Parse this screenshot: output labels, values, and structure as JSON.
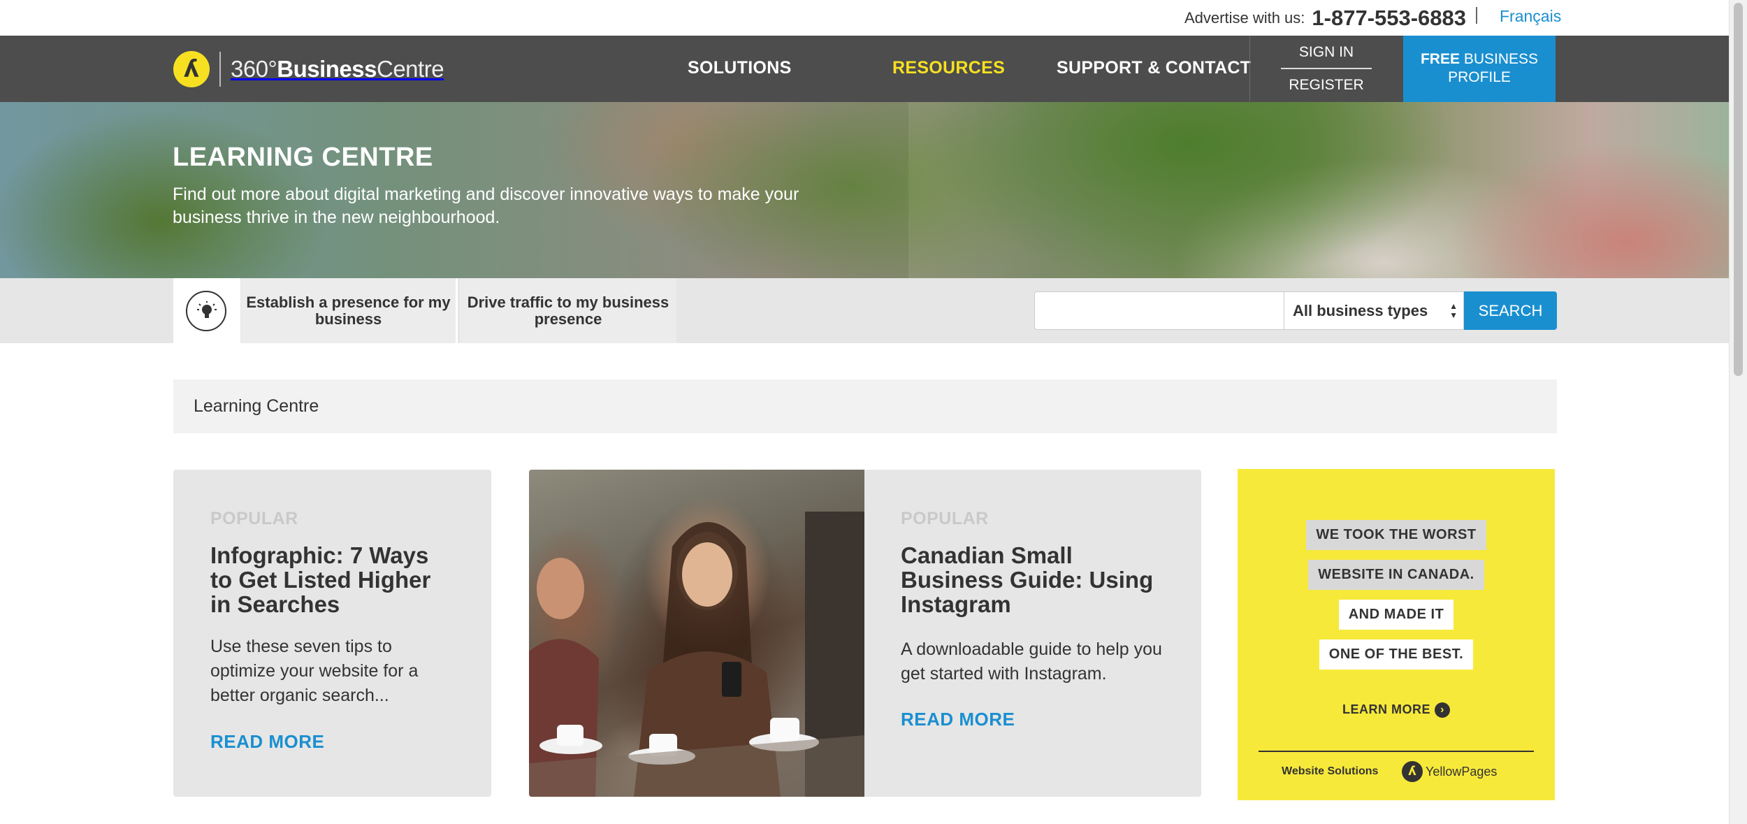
{
  "utility_bar": {
    "advertise_label": "Advertise with us:",
    "phone": "1-877-553-6883",
    "language_link": "Français"
  },
  "header": {
    "logo_text_light": "360°",
    "logo_text_bold": "Business",
    "logo_text_end": "Centre",
    "nav": [
      {
        "label": "SOLUTIONS"
      },
      {
        "label": "RESOURCES"
      },
      {
        "label": "SUPPORT & CONTACT"
      }
    ],
    "active_nav": "RESOURCES",
    "sign_in": "SIGN IN",
    "register": "REGISTER",
    "free_profile_bold": "FREE",
    "free_profile_rest": "BUSINESS PROFILE"
  },
  "hero": {
    "title": "LEARNING CENTRE",
    "subtitle": "Find out more about digital marketing and discover innovative ways to make your business thrive in the new neighbourhood."
  },
  "filter_bar": {
    "tabs": [
      {
        "label": "Establish a presence for my business"
      },
      {
        "label": "Drive traffic to my business presence"
      }
    ],
    "search_value": "",
    "search_placeholder": "",
    "business_type_selected": "All business types",
    "search_button": "SEARCH"
  },
  "breadcrumb": {
    "current": "Learning Centre"
  },
  "cards": [
    {
      "label": "POPULAR",
      "title": "Infographic: 7 Ways to Get Listed Higher in Searches",
      "description": "Use these seven tips to optimize your website for a better organic search...",
      "link": "READ MORE"
    },
    {
      "label": "POPULAR",
      "title": "Canadian Small Business Guide: Using Instagram",
      "description": "A downloadable guide to help you get started with Instagram.",
      "link": "READ MORE"
    }
  ],
  "ad": {
    "lines": [
      "WE TOOK THE WORST",
      "WEBSITE IN CANADA.",
      "AND MADE IT",
      "ONE OF THE BEST."
    ],
    "learn_more": "LEARN MORE",
    "footer_left": "Website Solutions",
    "footer_brand": "YellowPages"
  },
  "colors": {
    "accent_blue": "#1a8fd0",
    "brand_yellow": "#f7e021",
    "nav_bg": "#4d4d4d"
  },
  "icons": {
    "logo": "yellow-pages-logo-icon",
    "tab_icon": "lightbulb-icon",
    "learn_more": "chevron-right-circle-icon"
  }
}
